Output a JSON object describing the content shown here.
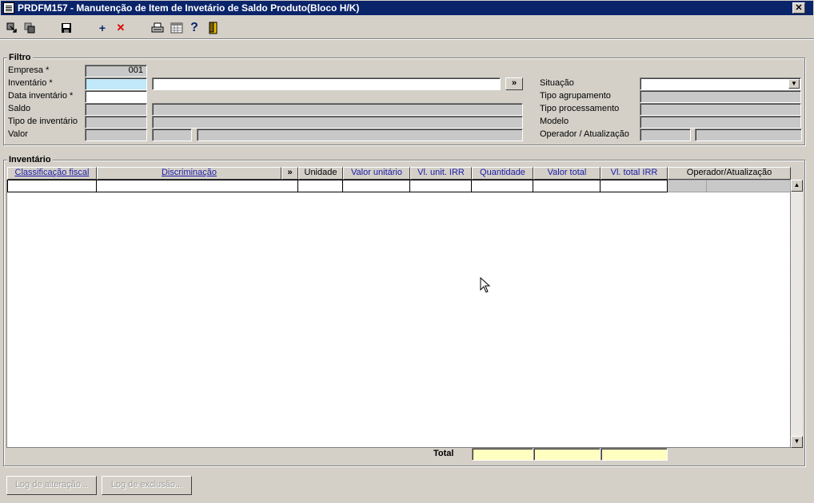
{
  "window": {
    "title": "PRDFM157 - Manutenção de Item de Invetário de Saldo Produto(Bloco H/K)",
    "close_label": "✕"
  },
  "toolbar": {
    "items": [
      "select-icon",
      "copy-icon",
      "save-icon",
      "add-icon",
      "delete-icon",
      "print-icon",
      "calendar-icon",
      "help-icon",
      "exit-icon"
    ],
    "add_label": "+",
    "delete_label": "✕",
    "help_label": "?"
  },
  "filter": {
    "title": "Filtro",
    "empresa_label": "Empresa *",
    "empresa_value": "001",
    "inventario_label": "Inventário *",
    "inventario_value": "",
    "inventario_desc": "",
    "more_label": "»",
    "data_inventario_label": "Data inventário *",
    "data_inventario_value": "",
    "saldo_label": "Saldo",
    "tipo_inventario_label": "Tipo de inventário",
    "valor_label": "Valor",
    "situacao_label": "Situação",
    "situacao_value": "",
    "tipo_agrupamento_label": "Tipo agrupamento",
    "tipo_processamento_label": "Tipo processamento",
    "modelo_label": "Modelo",
    "operador_label": "Operador / Atualização"
  },
  "inventario": {
    "title": "Inventário",
    "columns": {
      "classificacao": "Classificação fiscal",
      "discriminacao": "Discriminação",
      "more": "»",
      "unidade": "Unidade",
      "valor_unitario": "Valor unitário",
      "vl_unit_irr": "Vl. unit. IRR",
      "quantidade": "Quantidade",
      "valor_total": "Valor total",
      "vl_total_irr": "Vl. total IRR",
      "operador": "Operador/Atualização"
    },
    "total_label": "Total"
  },
  "buttons": {
    "log_alteracao": "Log de alteração...",
    "log_exclusao": "Log de exclusão..."
  },
  "colors": {
    "titlebar": "#0a246a",
    "required_field": "#c0e8f8",
    "total_field": "#ffffc0"
  }
}
